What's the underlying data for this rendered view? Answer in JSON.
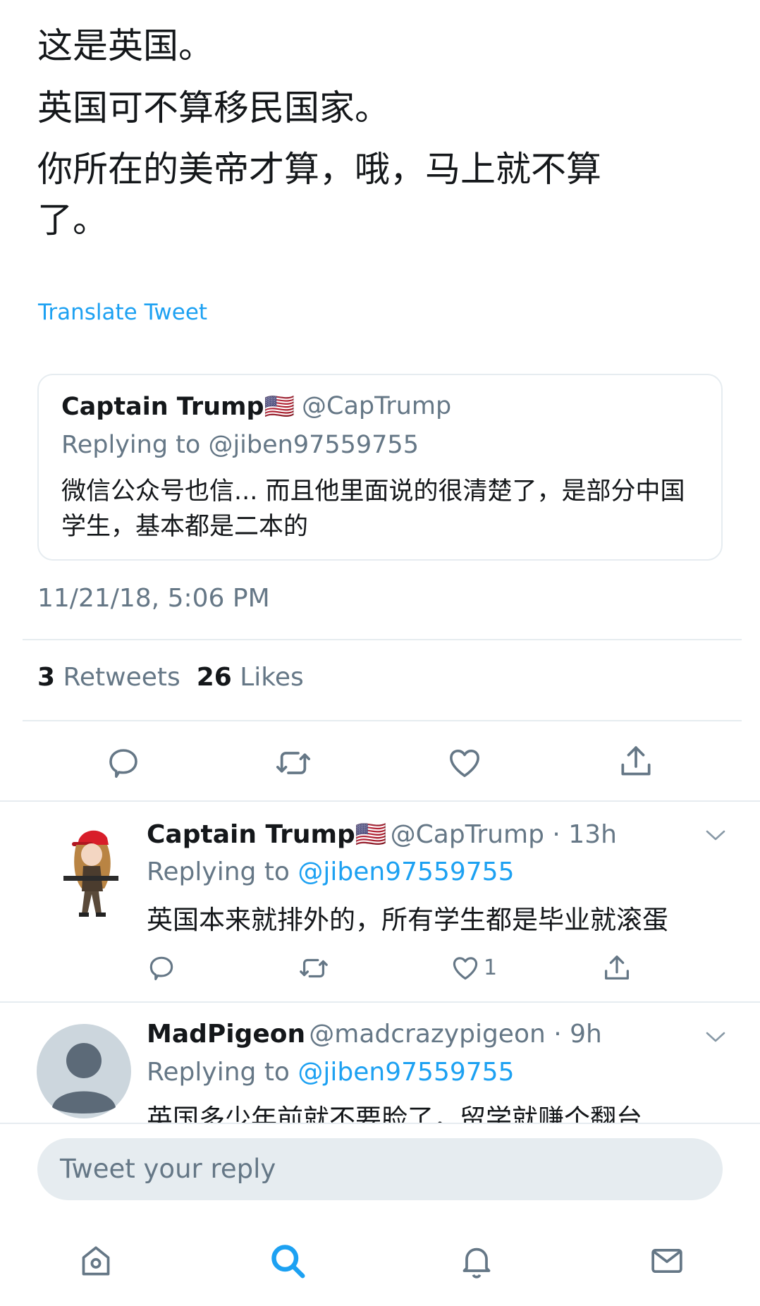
{
  "tweet": {
    "lines": [
      "这是英国。",
      "英国可不算移民国家。",
      "你所在的美帝才算，哦，马上就不算",
      "了。"
    ],
    "translate_label": "Translate Tweet",
    "quote": {
      "name": "Captain Trump🇺🇸",
      "handle": "@CapTrump",
      "replying_to": "Replying to @jiben97559755",
      "body": "微信公众号也信... 而且他里面说的很清楚了，是部分中国学生，基本都是二本的"
    },
    "timestamp": "11/21/18, 5:06 PM",
    "retweets_count": "3",
    "retweets_label": "Retweets",
    "likes_count": "26",
    "likes_label": "Likes",
    "actions": [
      {
        "icon": "reply-icon"
      },
      {
        "icon": "retweet-icon"
      },
      {
        "icon": "like-icon"
      },
      {
        "icon": "share-icon"
      }
    ]
  },
  "replies": [
    {
      "name": "Captain Trump🇺🇸",
      "handle": "@CapTrump · 13h",
      "replying_label": "Replying to",
      "mention": "@jiben97559755",
      "body": "英国本来就排外的，所有学生都是毕业就滚蛋",
      "like_count": "1",
      "avatar": "anime-character-avatar"
    },
    {
      "name": "MadPigeon",
      "handle": "@madcrazypigeon · 9h",
      "replying_label": "Replying to",
      "mention": "@jiben97559755",
      "body": "英国多少年前就不要脸了，留学就赚个翻台",
      "avatar": "default-user-avatar"
    }
  ],
  "reply_box": {
    "placeholder": "Tweet your reply"
  },
  "tab_bar": [
    {
      "icon": "home-icon",
      "active": false
    },
    {
      "icon": "search-icon",
      "active": true
    },
    {
      "icon": "notifications-icon",
      "active": false
    },
    {
      "icon": "messages-icon",
      "active": false
    }
  ],
  "colors": {
    "accent": "#1da1f2",
    "secondary_text": "#657786",
    "border": "#e6ecf0"
  }
}
